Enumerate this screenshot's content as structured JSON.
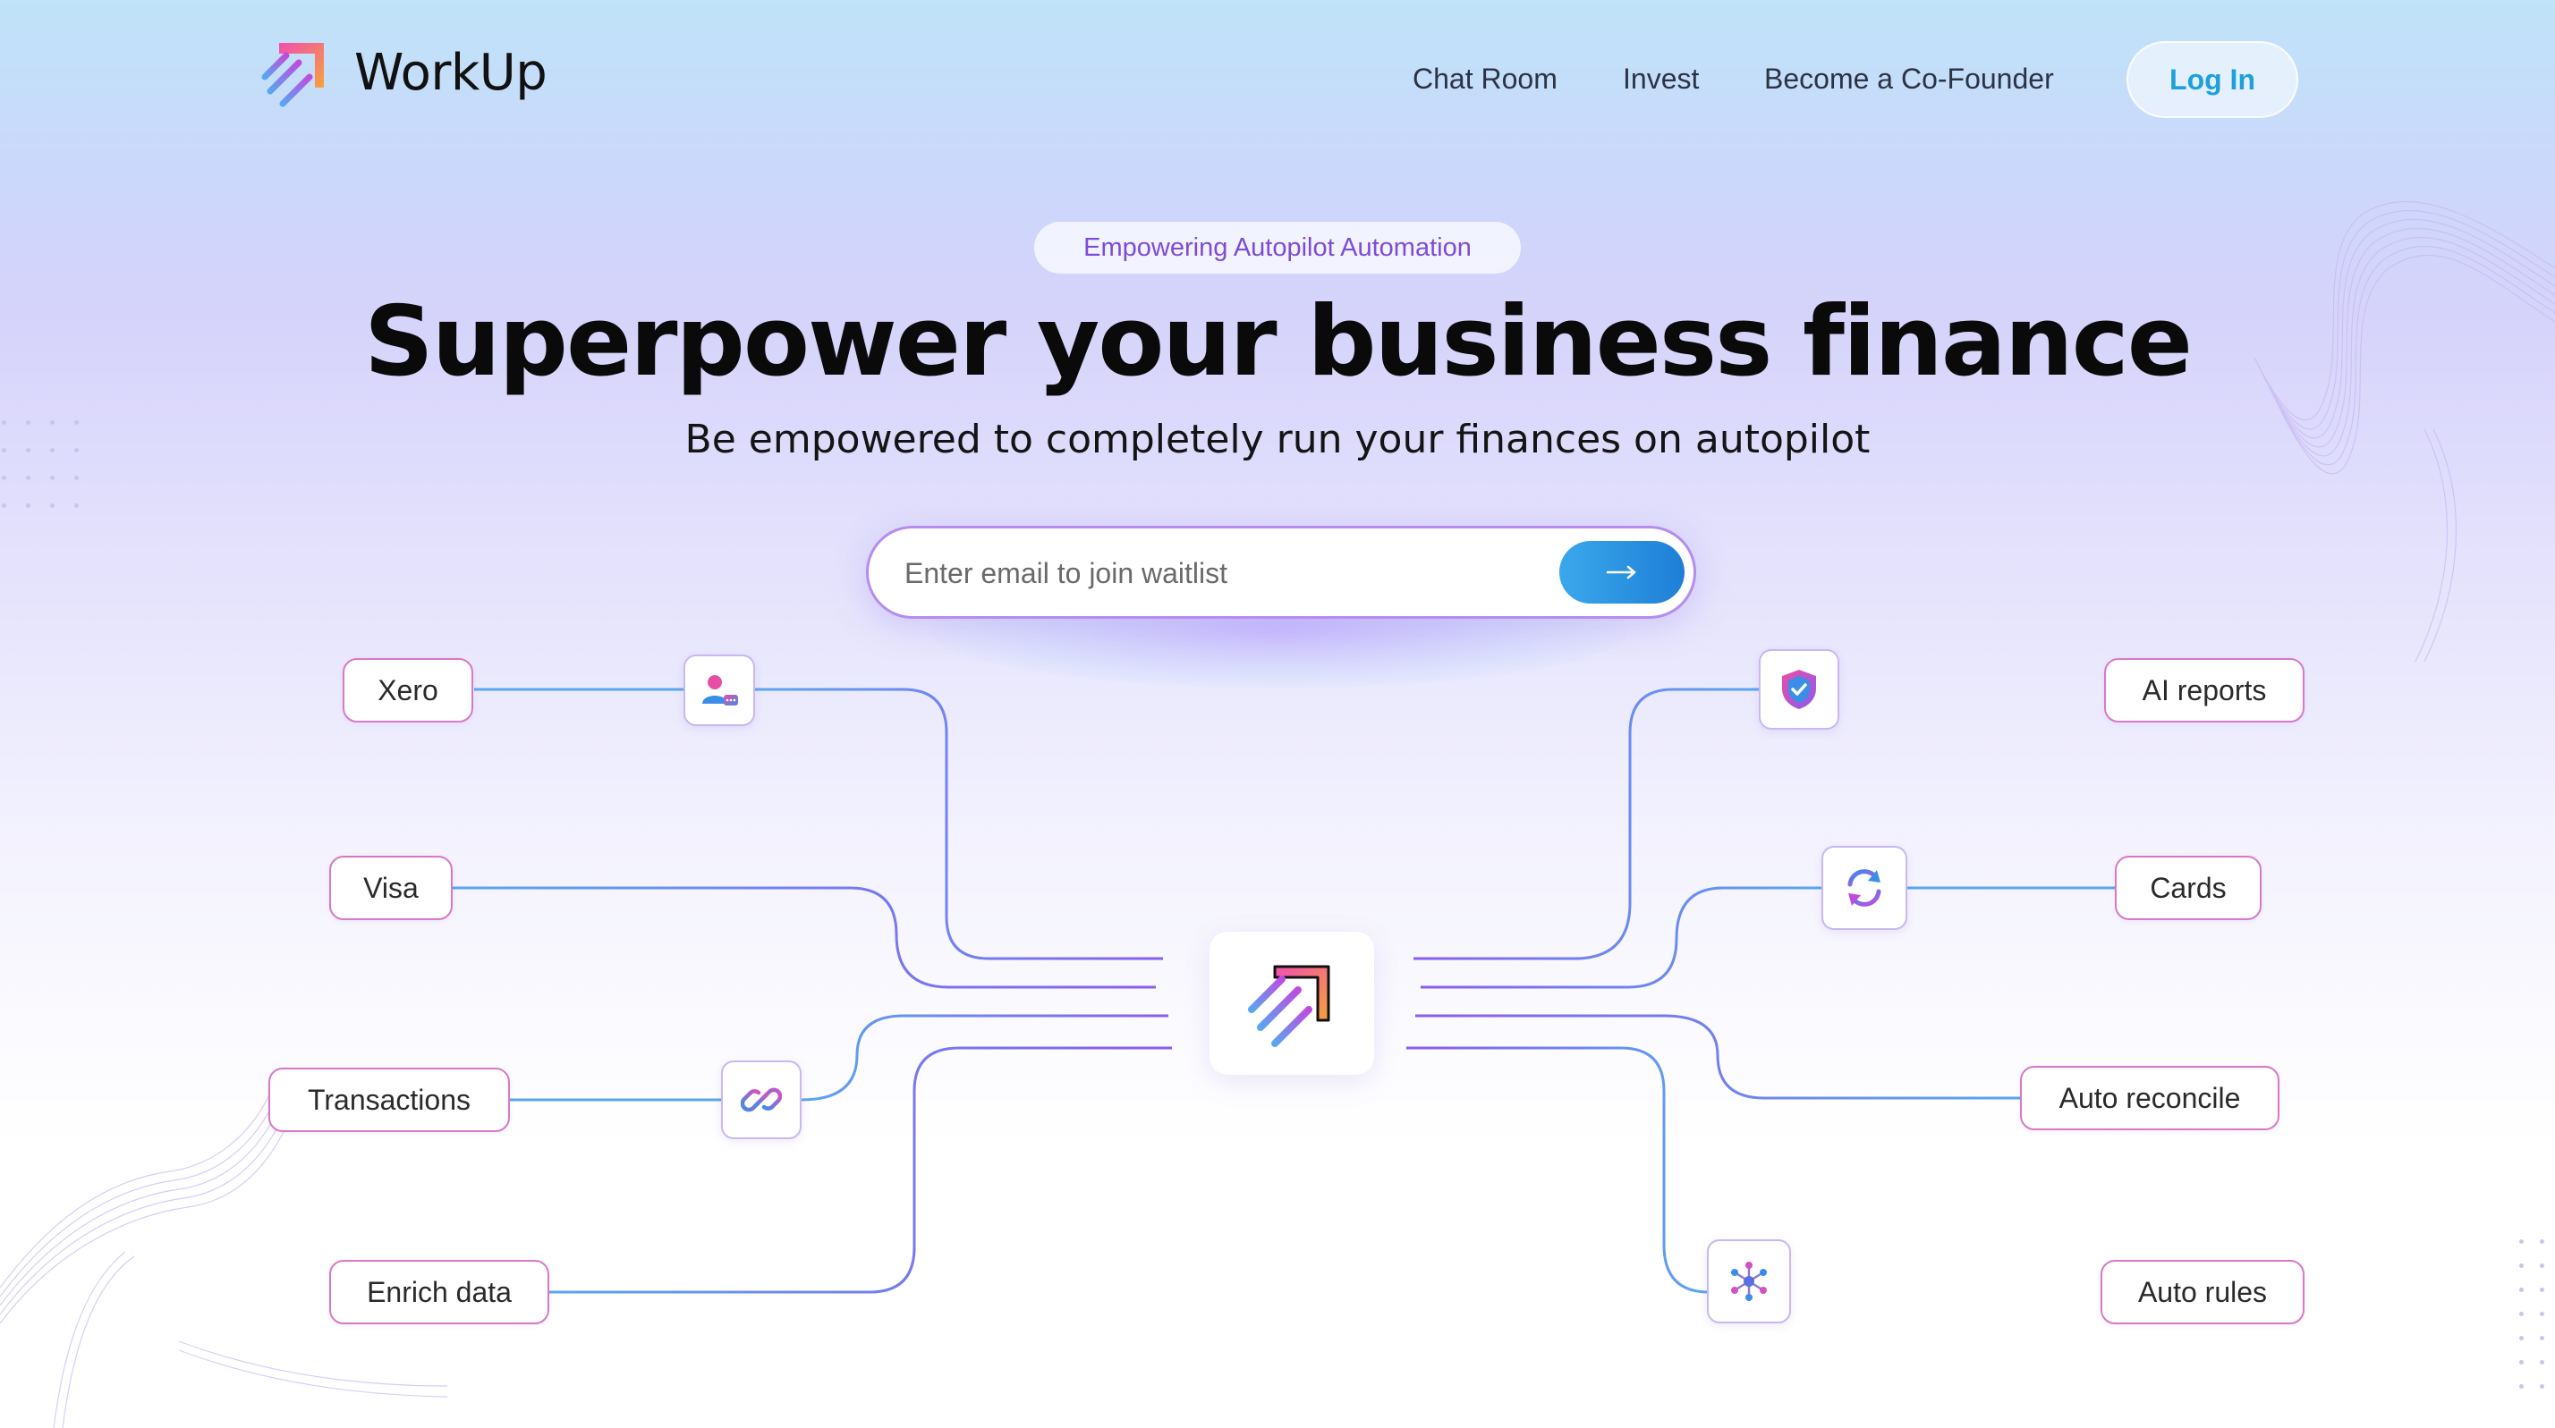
{
  "header": {
    "brand": "WorkUp",
    "nav": [
      "Chat Room",
      "Invest",
      "Become a Co-Founder"
    ],
    "login_label": "Log In"
  },
  "hero": {
    "badge": "Empowering Autopilot Automation",
    "title": "Superpower your business finance",
    "subtitle": "Be empowered to completely run your finances on autopilot",
    "email_placeholder": "Enter email to join waitlist",
    "submit_icon": "arrow-right-icon"
  },
  "integrations_left": [
    "Xero",
    "Visa",
    "Transactions",
    "Enrich data"
  ],
  "integrations_right": [
    "AI reports",
    "Cards",
    "Auto reconcile",
    "Auto rules"
  ],
  "icons": {
    "left": [
      "user-chat-icon",
      "link-icon"
    ],
    "right": [
      "shield-check-icon",
      "refresh-icon",
      "network-icon"
    ],
    "center": "workup-logo-icon"
  },
  "colors": {
    "accent_blue": "#1ea0de",
    "accent_purple": "#7e4cd8",
    "line_blue": "#5aa6f0",
    "line_purple": "#8a5cf0",
    "label_border": "#d978c8"
  }
}
